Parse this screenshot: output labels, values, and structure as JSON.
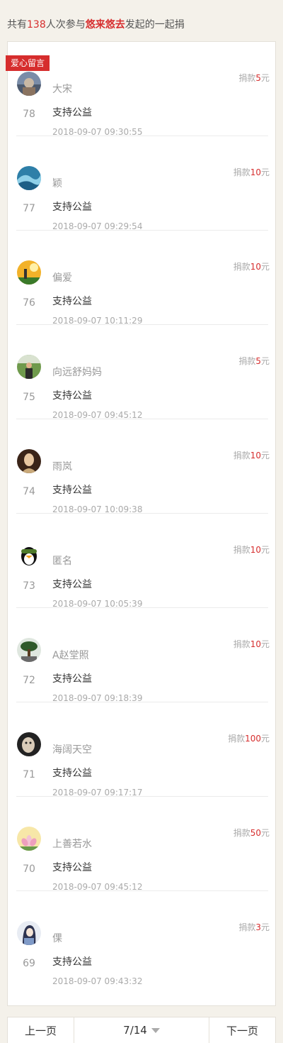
{
  "summary": {
    "prefix": "共有",
    "count": "138",
    "mid": "人次参与",
    "organizer": "悠来悠去",
    "suffix": "发起的一起捐"
  },
  "tag_label": "爱心留言",
  "amount_prefix": "捐款",
  "amount_unit": "元",
  "colors": {
    "accent": "#d62d2d",
    "background": "#f4f1ea"
  },
  "entries": [
    {
      "rank": "78",
      "name": "大宋",
      "message": "支持公益",
      "time": "2018-09-07 09:30:55",
      "amount": "5",
      "avatar": "avatar-grey-sky"
    },
    {
      "rank": "77",
      "name": "颖",
      "message": "支持公益",
      "time": "2018-09-07 09:29:54",
      "amount": "10",
      "avatar": "avatar-ocean-wave"
    },
    {
      "rank": "76",
      "name": "偏爱",
      "message": "支持公益",
      "time": "2018-09-07 10:11:29",
      "amount": "10",
      "avatar": "avatar-sunset-figure"
    },
    {
      "rank": "75",
      "name": "向远舒妈妈",
      "message": "支持公益",
      "time": "2018-09-07 09:45:12",
      "amount": "5",
      "avatar": "avatar-person-outdoor"
    },
    {
      "rank": "74",
      "name": "雨岚",
      "message": "支持公益",
      "time": "2018-09-07 10:09:38",
      "amount": "10",
      "avatar": "avatar-portrait-painting"
    },
    {
      "rank": "73",
      "name": "匿名",
      "message": "支持公益",
      "time": "2018-09-07 10:05:39",
      "amount": "10",
      "avatar": "avatar-qq-penguin"
    },
    {
      "rank": "72",
      "name": "A赵堂照",
      "message": "支持公益",
      "time": "2018-09-07 09:18:39",
      "amount": "10",
      "avatar": "avatar-bonsai-tree"
    },
    {
      "rank": "71",
      "name": "海阔天空",
      "message": "支持公益",
      "time": "2018-09-07 09:17:17",
      "amount": "100",
      "avatar": "avatar-dog-dark"
    },
    {
      "rank": "70",
      "name": "上善若水",
      "message": "支持公益",
      "time": "2018-09-07 09:45:12",
      "amount": "50",
      "avatar": "avatar-lotus-flower"
    },
    {
      "rank": "69",
      "name": "倮",
      "message": "支持公益",
      "time": "2018-09-07 09:43:32",
      "amount": "3",
      "avatar": "avatar-girl-drawing"
    }
  ],
  "pager": {
    "prev": "上一页",
    "current": "7/14",
    "next": "下一页"
  }
}
